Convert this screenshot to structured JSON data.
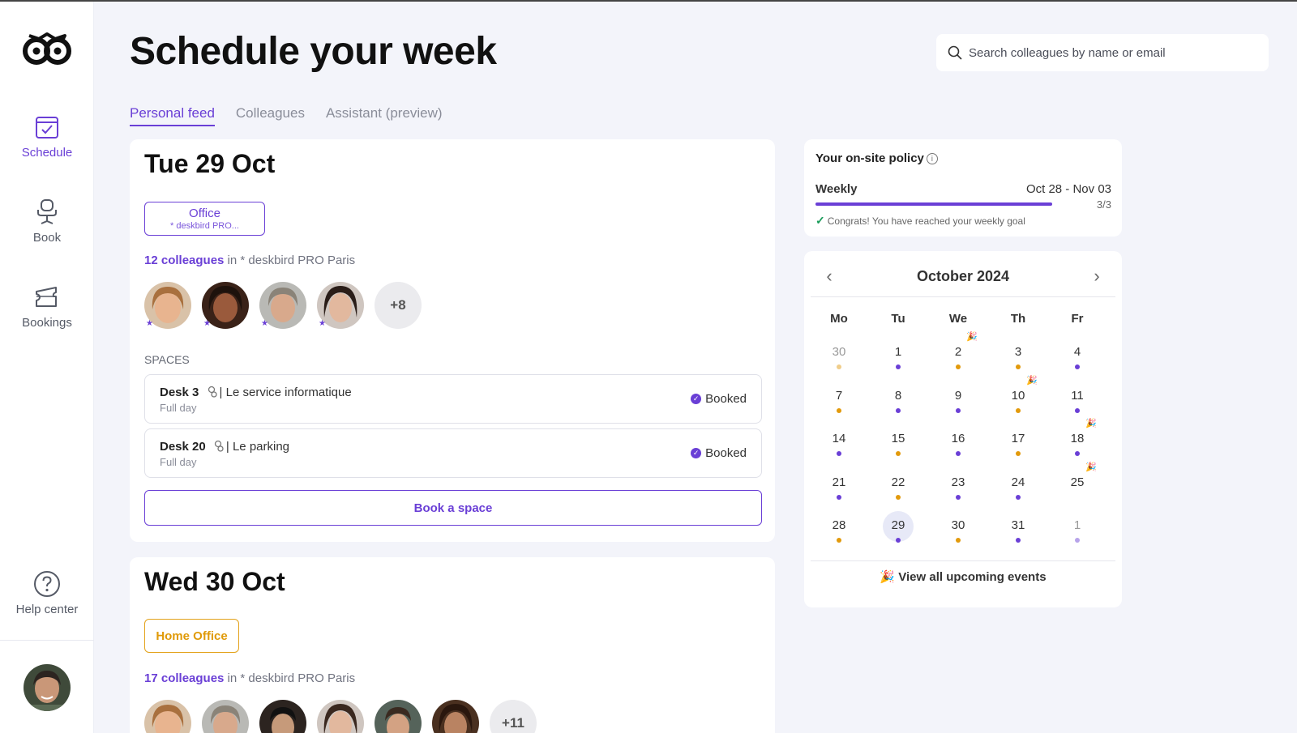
{
  "header": {
    "title": "Schedule your week",
    "search_placeholder": "Search colleagues by name or email"
  },
  "sidebar": {
    "items": [
      {
        "label": "Schedule",
        "icon": "calendar-check-icon",
        "active": true
      },
      {
        "label": "Book",
        "icon": "office-chair-icon",
        "active": false
      },
      {
        "label": "Bookings",
        "icon": "ticket-icon",
        "active": false
      }
    ],
    "help": {
      "label": "Help center",
      "icon": "help-circle-icon"
    }
  },
  "tabs": [
    {
      "label": "Personal feed",
      "active": true
    },
    {
      "label": "Colleagues",
      "active": false
    },
    {
      "label": "Assistant (preview)",
      "active": false
    }
  ],
  "days": [
    {
      "title": "Tue 29 Oct",
      "status_label": "Office",
      "status_sub": "* deskbird PRO...",
      "colleagues_count": "12 colleagues",
      "colleagues_in": " in * deskbird PRO Paris",
      "more_count": "+8",
      "spaces_label": "SPACES",
      "spaces": [
        {
          "name": "Desk 3",
          "area": "Le service informatique",
          "sub": "Full day",
          "status": "Booked"
        },
        {
          "name": "Desk 20",
          "area": "Le parking",
          "sub": "Full day",
          "status": "Booked"
        }
      ],
      "book_label": "Book a space"
    },
    {
      "title": "Wed 30 Oct",
      "status_label": "Home Office",
      "colleagues_count": "17 colleagues",
      "colleagues_in": " in * deskbird PRO Paris",
      "more_count": "+11"
    }
  ],
  "policy": {
    "title": "Your on-site policy",
    "frequency": "Weekly",
    "range": "Oct 28 - Nov 03",
    "count": "3/3",
    "progress": 1.0,
    "message": "Congrats! You have reached your weekly goal"
  },
  "calendar": {
    "month_label": "October  2024",
    "weekdays": [
      "Mo",
      "Tu",
      "We",
      "Th",
      "Fr"
    ],
    "weeks": [
      [
        {
          "d": "30",
          "dot": "orange-light",
          "muted": true
        },
        {
          "d": "1",
          "dot": "purple"
        },
        {
          "d": "2",
          "dot": "orange",
          "event": true
        },
        {
          "d": "3",
          "dot": "orange"
        },
        {
          "d": "4",
          "dot": "purple"
        }
      ],
      [
        {
          "d": "7",
          "dot": "orange"
        },
        {
          "d": "8",
          "dot": "purple"
        },
        {
          "d": "9",
          "dot": "purple"
        },
        {
          "d": "10",
          "dot": "orange",
          "event": true
        },
        {
          "d": "11",
          "dot": "purple"
        }
      ],
      [
        {
          "d": "14",
          "dot": "purple"
        },
        {
          "d": "15",
          "dot": "orange"
        },
        {
          "d": "16",
          "dot": "purple"
        },
        {
          "d": "17",
          "dot": "orange"
        },
        {
          "d": "18",
          "dot": "purple",
          "event": true
        }
      ],
      [
        {
          "d": "21",
          "dot": "purple"
        },
        {
          "d": "22",
          "dot": "orange"
        },
        {
          "d": "23",
          "dot": "purple"
        },
        {
          "d": "24",
          "dot": "purple"
        },
        {
          "d": "25",
          "event": true
        }
      ],
      [
        {
          "d": "28",
          "dot": "orange"
        },
        {
          "d": "29",
          "dot": "purple",
          "today": true
        },
        {
          "d": "30",
          "dot": "orange"
        },
        {
          "d": "31",
          "dot": "purple"
        },
        {
          "d": "1",
          "dot": "purple-light",
          "muted": true
        }
      ]
    ],
    "footer": "View all upcoming events"
  },
  "colors": {
    "accent": "#6a3fd6",
    "home": "#e09a08",
    "dot_purple": "#6a3fd6",
    "dot_orange": "#e29a0c"
  }
}
